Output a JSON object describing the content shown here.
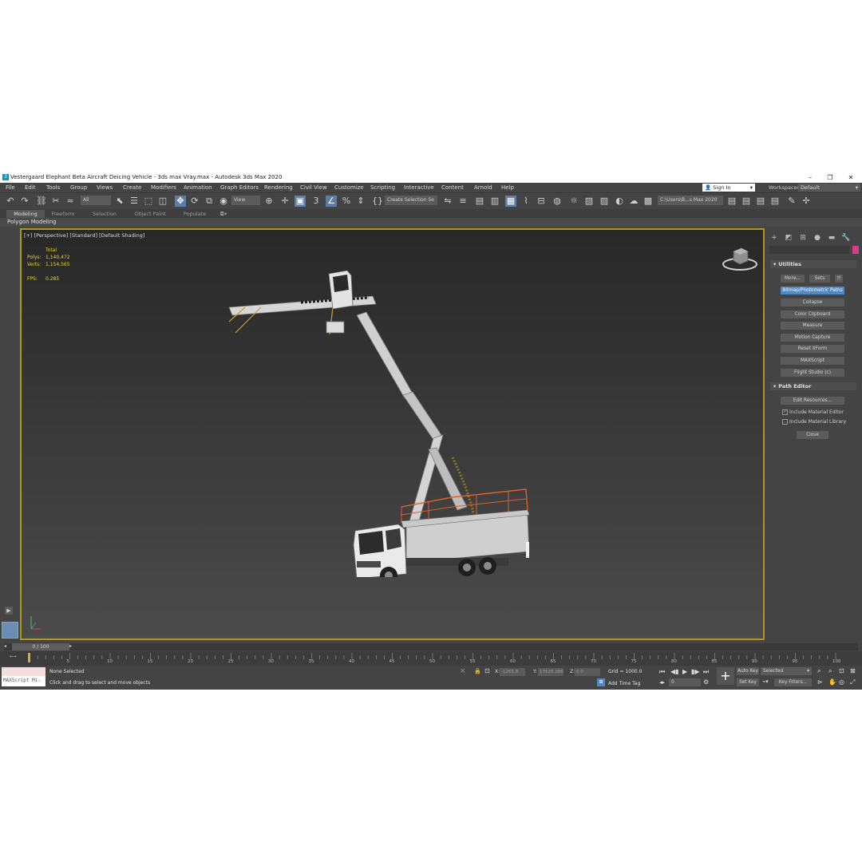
{
  "window": {
    "title": "Vestergaard Elephant Beta Aircraft Deicing Vehicle - 3ds max Vray.max - Autodesk 3ds Max 2020"
  },
  "menu": [
    "File",
    "Edit",
    "Tools",
    "Group",
    "Views",
    "Create",
    "Modifiers",
    "Animation",
    "Graph Editors",
    "Rendering",
    "Civil View",
    "Customize",
    "Scripting",
    "Interactive",
    "Content",
    "Arnold",
    "Help"
  ],
  "account": {
    "sign_in": "Sign In",
    "workspaces_label": "Workspaces:",
    "workspace_value": "Default"
  },
  "toolbar": {
    "filter": "All",
    "ref_coord": "View",
    "selection_set": "Create Selection Se",
    "project_path": "C:\\Users\\B...s Max 2020"
  },
  "ribbon": {
    "tabs": [
      "Modeling",
      "Freeform",
      "Selection",
      "Object Paint",
      "Populate"
    ],
    "active": "Modeling",
    "sub": "Polygon Modeling"
  },
  "viewport": {
    "label": "[+] [Perspective] [Standard] [Default Shading]",
    "stats": {
      "total_label": "Total",
      "polys_label": "Polys:",
      "polys_value": "1,140,472",
      "verts_label": "Verts:",
      "verts_value": "1,154,565",
      "fps_label": "FPS:",
      "fps_value": "0.285"
    }
  },
  "command_panel": {
    "utilities": {
      "title": "Utilities",
      "more": "More...",
      "sets": "Sets",
      "buttons": [
        "Bitmap/Photometric Paths",
        "Collapse",
        "Color Clipboard",
        "Measure",
        "Motion Capture",
        "Reset XForm",
        "MAXScript",
        "Flight Studio (c)"
      ],
      "active": "Bitmap/Photometric Paths"
    },
    "path_editor": {
      "title": "Path Editor",
      "edit_resources": "Edit Resources...",
      "include_material_editor": "Include Material Editor",
      "include_material_library": "Include Material Library",
      "close": "Close"
    }
  },
  "timeline": {
    "frame": "0 / 100",
    "ticks": [
      "5",
      "10",
      "15",
      "20",
      "25",
      "30",
      "35",
      "40",
      "45",
      "50",
      "55",
      "60",
      "65",
      "70",
      "75",
      "80",
      "85",
      "90",
      "95",
      "100"
    ]
  },
  "status": {
    "maxscript": "MAXScript Mi:",
    "selection": "None Selected",
    "prompt": "Click and drag to select and move objects",
    "x_label": "X:",
    "x_value": "-1265.8",
    "y_label": "Y:",
    "y_value": "17625.386",
    "z_label": "Z:",
    "z_value": "0.0",
    "grid": "Grid = 1000.0",
    "add_time_tag": "Add Time Tag",
    "frame_field": "0",
    "auto_key": "Auto Key",
    "set_key": "Set Key",
    "selected": "Selected",
    "key_filters": "Key Filters..."
  }
}
